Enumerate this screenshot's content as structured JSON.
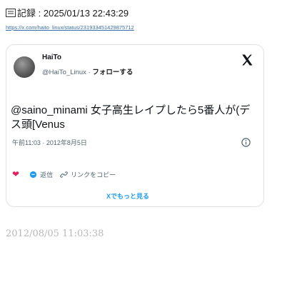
{
  "record": {
    "label": "記録",
    "datetime": "2025/01/13 22:43:29",
    "url": "https://x.com/haito_linux/status/231933451429875712"
  },
  "tweet": {
    "display_name": "HaiTo",
    "handle": "@HaiTo_Linux",
    "separator": "·",
    "follow_label": "フォローする",
    "text": "@saino_minami 女子高生レイプしたら5番人が(デス頭[Venus",
    "time": "午前11:03 · 2012年8月5日",
    "actions": {
      "like_count": "",
      "reply_label": "返信",
      "copy_link_label": "リンクをコピー"
    },
    "more_label": "Xでもっと見る"
  },
  "stamp": "2012/08/05 11:03:38",
  "colors": {
    "link": "#1d9bf0",
    "heart": "#e0245e",
    "muted": "#536471"
  }
}
